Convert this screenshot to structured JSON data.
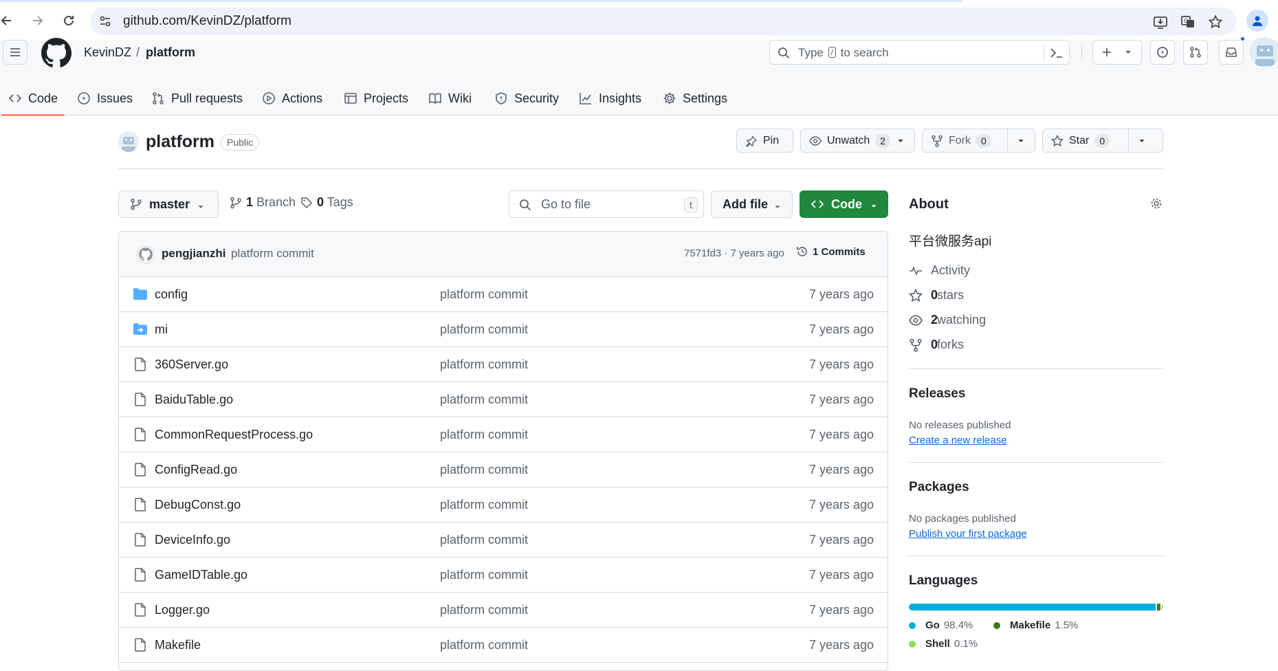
{
  "browser": {
    "url_host": "github.com",
    "url_path": "/KevinDZ/platform"
  },
  "header": {
    "owner": "KevinDZ",
    "separator": "/",
    "repo": "platform",
    "search_prefix": "Type",
    "search_key": "/",
    "search_suffix": "to search"
  },
  "nav": {
    "items": [
      {
        "label": "Code",
        "icon": "code-icon"
      },
      {
        "label": "Issues",
        "icon": "issue-opened-icon"
      },
      {
        "label": "Pull requests",
        "icon": "git-pull-request-icon"
      },
      {
        "label": "Actions",
        "icon": "play-icon"
      },
      {
        "label": "Projects",
        "icon": "table-icon"
      },
      {
        "label": "Wiki",
        "icon": "book-icon"
      },
      {
        "label": "Security",
        "icon": "shield-icon"
      },
      {
        "label": "Insights",
        "icon": "graph-icon"
      },
      {
        "label": "Settings",
        "icon": "gear-icon"
      }
    ],
    "active": "Code"
  },
  "repo": {
    "name": "platform",
    "visibility": "Public",
    "pin_label": "Pin",
    "watch_label": "Unwatch",
    "watch_count": "2",
    "fork_label": "Fork",
    "fork_count": "0",
    "star_label": "Star",
    "star_count": "0"
  },
  "browser_bar": {
    "branch": "master",
    "branch_count": "1",
    "branch_word": "Branch",
    "tag_count": "0",
    "tag_word": "Tags",
    "goto_placeholder": "Go to file",
    "goto_key": "t",
    "add_file_label": "Add file",
    "code_label": "Code"
  },
  "commit": {
    "author": "pengjianzhi",
    "message": "platform commit",
    "meta": "7571fd3 · 7 years ago",
    "count_label": "1 Commits"
  },
  "files": [
    {
      "name": "config",
      "type": "folder",
      "message": "platform commit",
      "age": "7 years ago"
    },
    {
      "name": "mi",
      "type": "submodule",
      "message": "platform commit",
      "age": "7 years ago"
    },
    {
      "name": "360Server.go",
      "type": "file",
      "message": "platform commit",
      "age": "7 years ago"
    },
    {
      "name": "BaiduTable.go",
      "type": "file",
      "message": "platform commit",
      "age": "7 years ago"
    },
    {
      "name": "CommonRequestProcess.go",
      "type": "file",
      "message": "platform commit",
      "age": "7 years ago"
    },
    {
      "name": "ConfigRead.go",
      "type": "file",
      "message": "platform commit",
      "age": "7 years ago"
    },
    {
      "name": "DebugConst.go",
      "type": "file",
      "message": "platform commit",
      "age": "7 years ago"
    },
    {
      "name": "DeviceInfo.go",
      "type": "file",
      "message": "platform commit",
      "age": "7 years ago"
    },
    {
      "name": "GameIDTable.go",
      "type": "file",
      "message": "platform commit",
      "age": "7 years ago"
    },
    {
      "name": "Logger.go",
      "type": "file",
      "message": "platform commit",
      "age": "7 years ago"
    },
    {
      "name": "Makefile",
      "type": "file",
      "message": "platform commit",
      "age": "7 years ago"
    }
  ],
  "sidebar": {
    "about_title": "About",
    "description": "平台微服务api",
    "activity_label": "Activity",
    "stars_count": "0",
    "stars_label": "stars",
    "watching_count": "2",
    "watching_label": "watching",
    "forks_count": "0",
    "forks_label": "forks",
    "releases_title": "Releases",
    "releases_note": "No releases published",
    "releases_link": "Create a new release",
    "packages_title": "Packages",
    "packages_note": "No packages published",
    "packages_link": "Publish your first package",
    "languages_title": "Languages",
    "languages": [
      {
        "name": "Go",
        "percent": "98.4%",
        "value": 98.4,
        "color": "#00ADD8"
      },
      {
        "name": "Makefile",
        "percent": "1.5%",
        "value": 1.5,
        "color": "#427819"
      },
      {
        "name": "Shell",
        "percent": "0.1%",
        "value": 0.1,
        "color": "#89e051"
      }
    ]
  },
  "colors": {
    "accent": "#0969da",
    "code_button": "#1f883d",
    "active_tab": "#fd8c73",
    "folder": "#54aeff"
  }
}
